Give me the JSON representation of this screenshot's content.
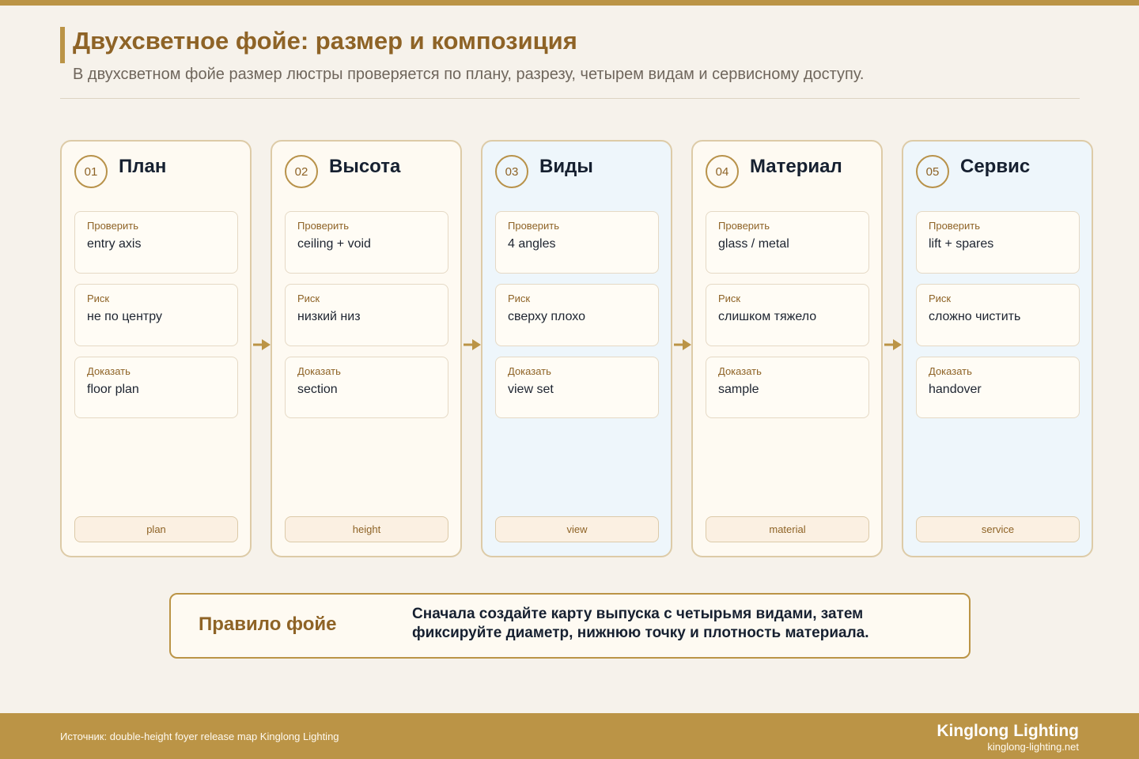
{
  "header": {
    "title": "Двухсветное фойе: размер и композиция",
    "subtitle": "В двухсветном фойе размер люстры проверяется по плану, разрезу, четырем видам и сервисному доступу."
  },
  "stages": [
    {
      "number": "01",
      "title": "План",
      "tint": "warm",
      "items": [
        {
          "label": "Проверить",
          "value": "entry axis"
        },
        {
          "label": "Риск",
          "value": "не по центру"
        },
        {
          "label": "Доказать",
          "value": "floor plan"
        }
      ],
      "tag": "plan"
    },
    {
      "number": "02",
      "title": "Высота",
      "tint": "warm",
      "items": [
        {
          "label": "Проверить",
          "value": "ceiling + void"
        },
        {
          "label": "Риск",
          "value": "низкий низ"
        },
        {
          "label": "Доказать",
          "value": "section"
        }
      ],
      "tag": "height"
    },
    {
      "number": "03",
      "title": "Виды",
      "tint": "blue",
      "items": [
        {
          "label": "Проверить",
          "value": "4 angles"
        },
        {
          "label": "Риск",
          "value": "сверху плохо"
        },
        {
          "label": "Доказать",
          "value": "view set"
        }
      ],
      "tag": "view"
    },
    {
      "number": "04",
      "title": "Материал",
      "tint": "warm",
      "items": [
        {
          "label": "Проверить",
          "value": "glass / metal"
        },
        {
          "label": "Риск",
          "value": "слишком тяжело"
        },
        {
          "label": "Доказать",
          "value": "sample"
        }
      ],
      "tag": "material"
    },
    {
      "number": "05",
      "title": "Сервис",
      "tint": "blue",
      "items": [
        {
          "label": "Проверить",
          "value": "lift + spares"
        },
        {
          "label": "Риск",
          "value": "сложно чистить"
        },
        {
          "label": "Доказать",
          "value": "handover"
        }
      ],
      "tag": "service"
    }
  ],
  "rule": {
    "title": "Правило фойе",
    "text": "Сначала создайте карту выпуска с четырьмя видами, затем фиксируйте диаметр, нижнюю точку и плотность материала."
  },
  "footer": {
    "source": "Источник: double-height foyer release map Kinglong Lighting",
    "brand": "Kinglong Lighting",
    "url": "kinglong-lighting.net"
  },
  "colors": {
    "accent": "#bb9446",
    "background": "#f6f2eb",
    "card_warm": "#fefaf2",
    "card_blue": "#eef6fb"
  }
}
